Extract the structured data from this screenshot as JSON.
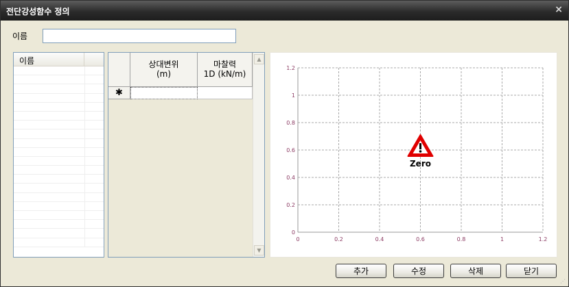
{
  "window": {
    "title": "전단강성함수 정의",
    "close_glyph": "×"
  },
  "name_field": {
    "label": "이름",
    "value": ""
  },
  "list": {
    "header": "이름",
    "row_count": 20
  },
  "grid": {
    "headers": [
      {
        "line1": "상대변위",
        "line2": "(m)"
      },
      {
        "line1": "마찰력",
        "line2": "1D (kN/m)"
      }
    ],
    "new_row_marker": "✱"
  },
  "chart_data": {
    "type": "line",
    "title": "",
    "xlabel": "",
    "ylabel": "",
    "series": [],
    "xlim": [
      0,
      1.2
    ],
    "ylim": [
      0,
      1.2
    ],
    "x_ticks": [
      "0",
      "0.2",
      "0.4",
      "0.6",
      "0.8",
      "1",
      "1.2"
    ],
    "y_ticks": [
      "0",
      "0.2",
      "0.4",
      "0.6",
      "0.8",
      "1",
      "1.2"
    ],
    "grid": true,
    "tick_color": "#8b3a62",
    "warning_label": "Zero",
    "warning_color": "#e00000"
  },
  "buttons": {
    "add": "추가",
    "edit": "수정",
    "delete": "삭제",
    "close": "닫기"
  }
}
